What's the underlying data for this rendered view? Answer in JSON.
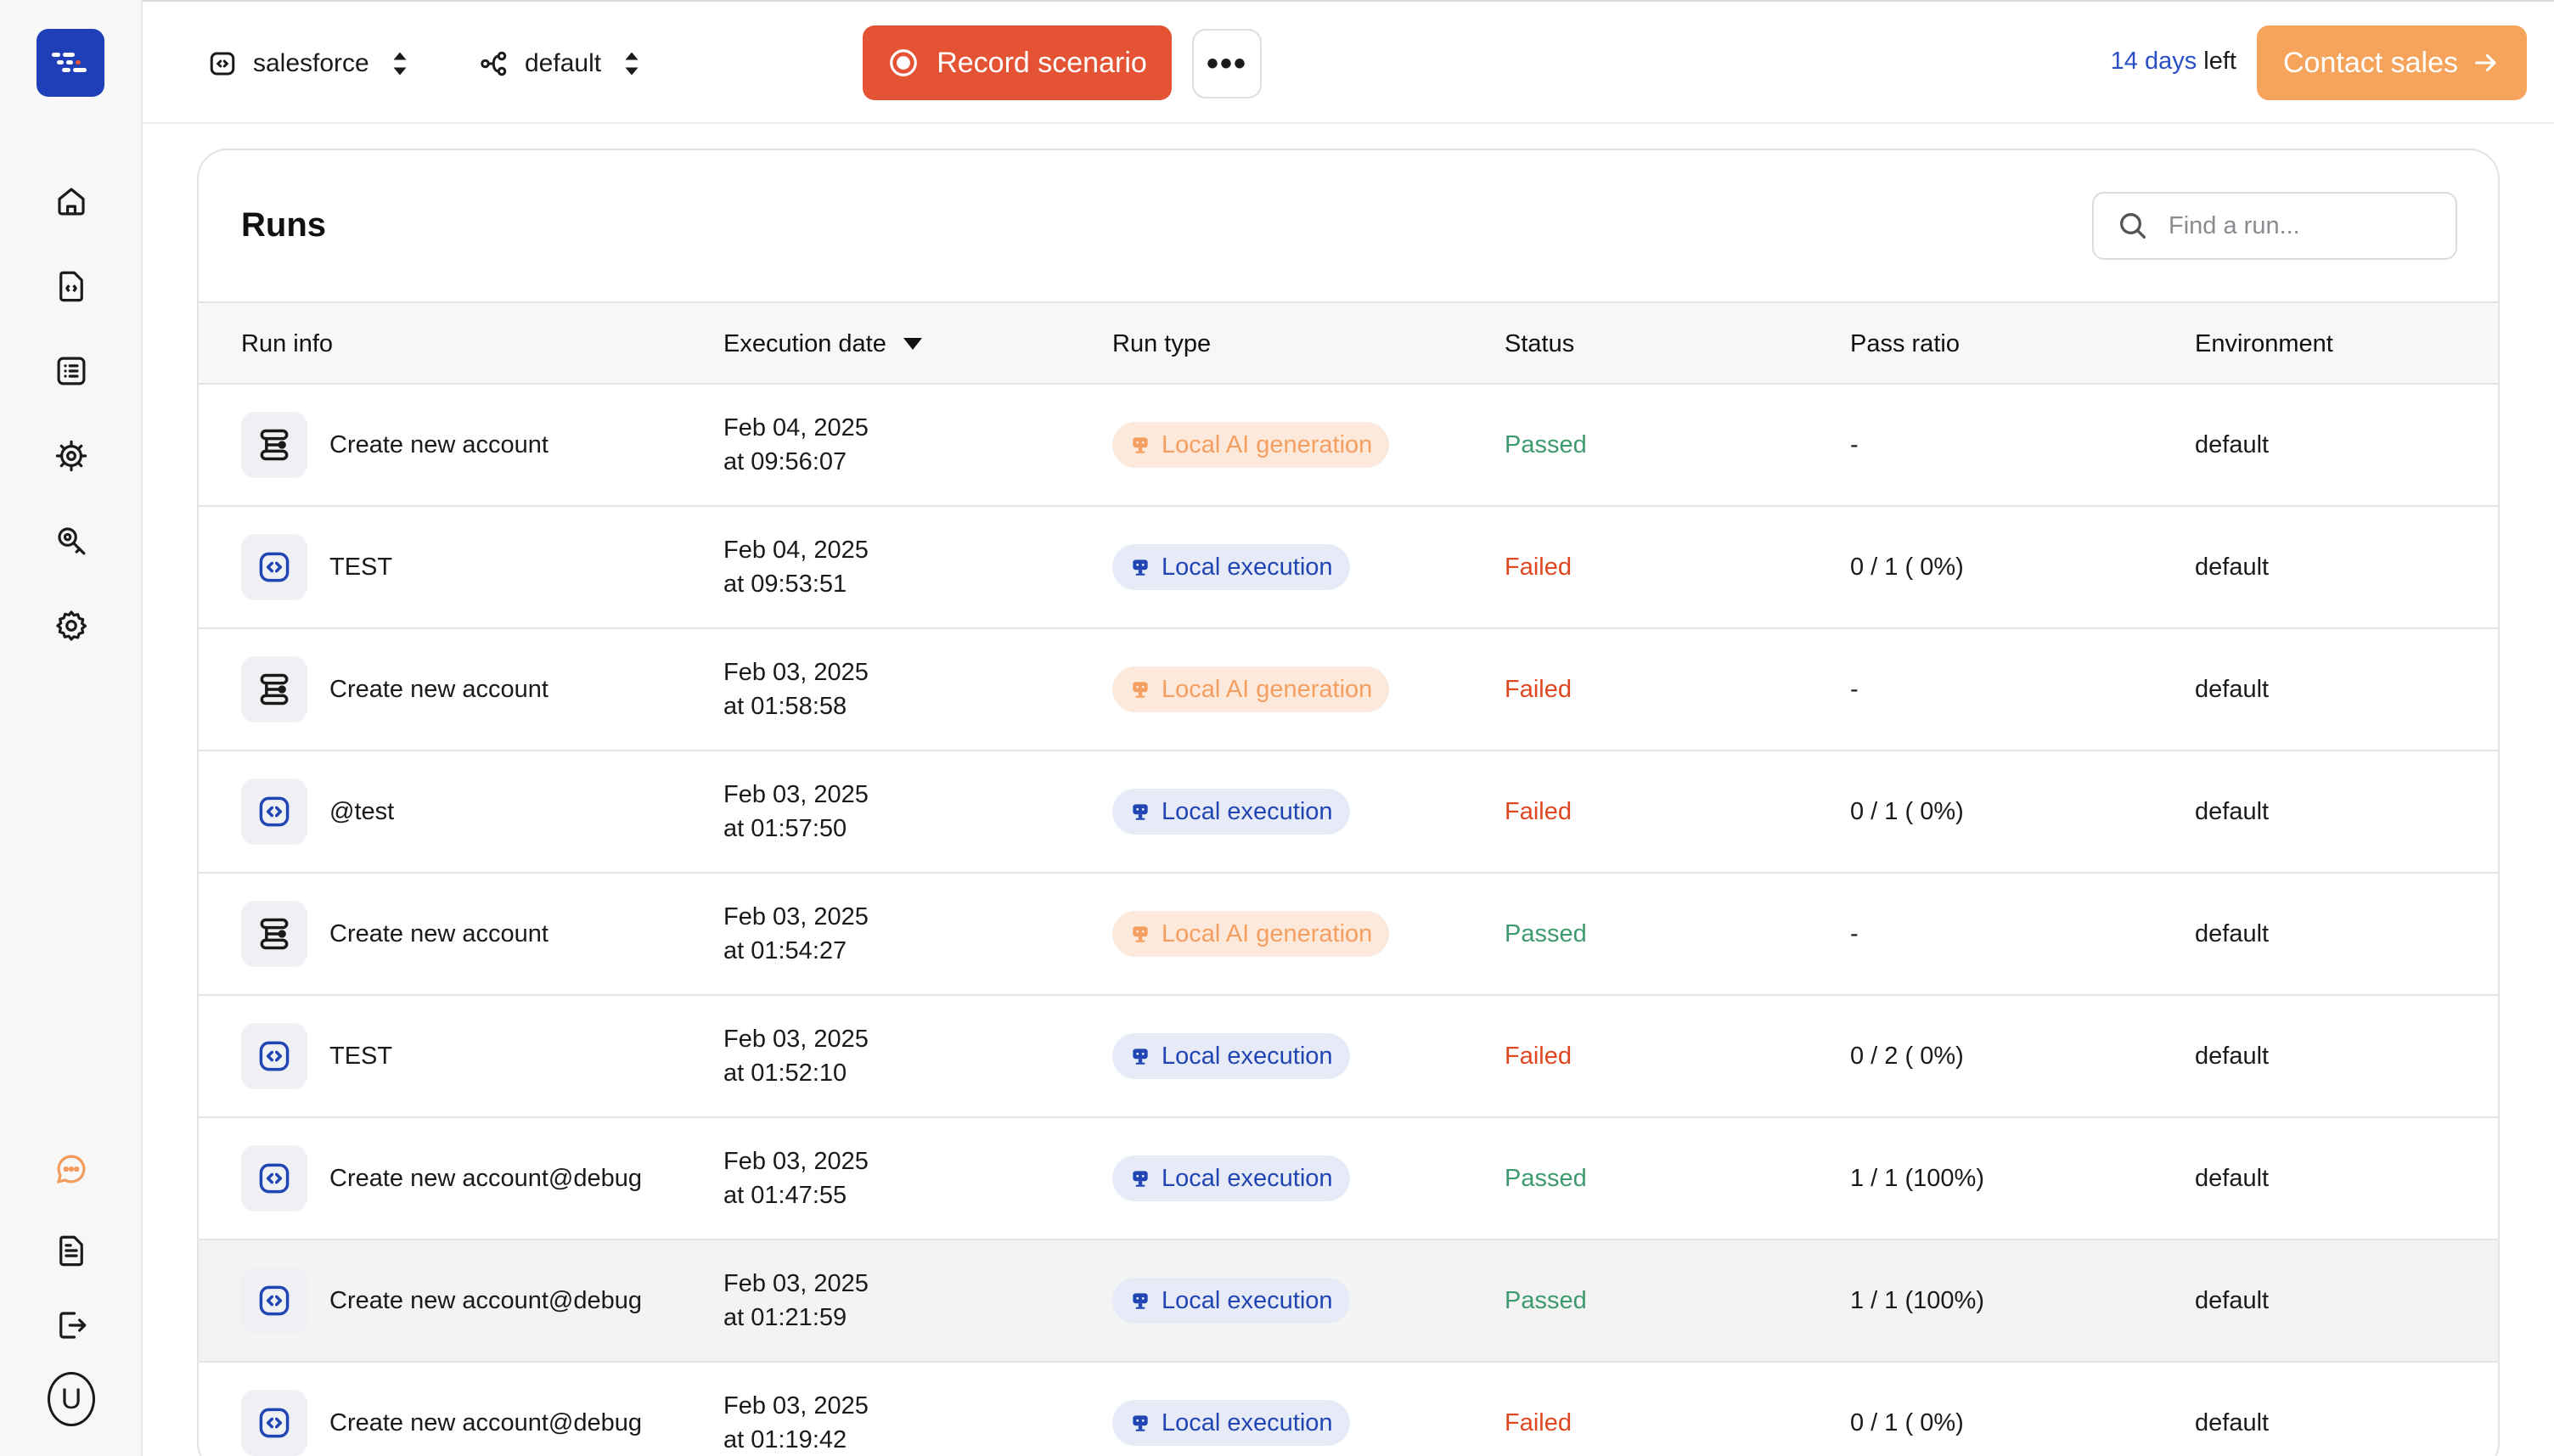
{
  "colors": {
    "brand": "#1f3fb8",
    "record": "#e45434",
    "contact": "#f6a45b",
    "passed": "#3d9a6e",
    "failed": "#e0461f"
  },
  "sidebar": {
    "logo_icon": "dash-logo-icon",
    "nav_top": [
      "home-icon",
      "scenario-file-icon",
      "list-icon",
      "bug-settings-icon",
      "search-key-icon",
      "settings-icon"
    ],
    "nav_bottom": [
      "chat-icon",
      "document-icon",
      "logout-icon"
    ],
    "avatar_letter": "U"
  },
  "topbar": {
    "project": "salesforce",
    "environment": "default",
    "record_label": "Record scenario",
    "more_label": "•••",
    "trial_days": "14 days",
    "trial_suffix": " left",
    "contact_label": "Contact sales"
  },
  "runs": {
    "title": "Runs",
    "search_placeholder": "Find a run...",
    "columns": {
      "run_info": "Run info",
      "execution_date": "Execution date",
      "run_type": "Run type",
      "status": "Status",
      "pass_ratio": "Pass ratio",
      "environment": "Environment"
    },
    "rows": [
      {
        "icon": "flow",
        "name": "Create new account",
        "date": "Feb 04, 2025",
        "time": "at 09:56:07",
        "type": "Local AI generation",
        "type_kind": "ai",
        "status": "Passed",
        "ratio": "-",
        "env": "default"
      },
      {
        "icon": "code",
        "name": "TEST",
        "date": "Feb 04, 2025",
        "time": "at 09:53:51",
        "type": "Local execution",
        "type_kind": "exec",
        "status": "Failed",
        "ratio": "0 / 1 ( 0%)",
        "env": "default"
      },
      {
        "icon": "flow",
        "name": "Create new account",
        "date": "Feb 03, 2025",
        "time": "at 01:58:58",
        "type": "Local AI generation",
        "type_kind": "ai",
        "status": "Failed",
        "ratio": "-",
        "env": "default"
      },
      {
        "icon": "code",
        "name": "@test",
        "date": "Feb 03, 2025",
        "time": "at 01:57:50",
        "type": "Local execution",
        "type_kind": "exec",
        "status": "Failed",
        "ratio": "0 / 1 ( 0%)",
        "env": "default"
      },
      {
        "icon": "flow",
        "name": "Create new account",
        "date": "Feb 03, 2025",
        "time": "at 01:54:27",
        "type": "Local AI generation",
        "type_kind": "ai",
        "status": "Passed",
        "ratio": "-",
        "env": "default"
      },
      {
        "icon": "code",
        "name": "TEST",
        "date": "Feb 03, 2025",
        "time": "at 01:52:10",
        "type": "Local execution",
        "type_kind": "exec",
        "status": "Failed",
        "ratio": "0 / 2 ( 0%)",
        "env": "default"
      },
      {
        "icon": "code",
        "name": "Create new account@debug",
        "date": "Feb 03, 2025",
        "time": "at 01:47:55",
        "type": "Local execution",
        "type_kind": "exec",
        "status": "Passed",
        "ratio": "1 / 1 (100%)",
        "env": "default"
      },
      {
        "icon": "code",
        "name": "Create new account@debug",
        "date": "Feb 03, 2025",
        "time": "at 01:21:59",
        "type": "Local execution",
        "type_kind": "exec",
        "status": "Passed",
        "ratio": "1 / 1 (100%)",
        "env": "default"
      },
      {
        "icon": "code",
        "name": "Create new account@debug",
        "date": "Feb 03, 2025",
        "time": "at 01:19:42",
        "type": "Local execution",
        "type_kind": "exec",
        "status": "Failed",
        "ratio": "0 / 1 ( 0%)",
        "env": "default"
      }
    ]
  }
}
